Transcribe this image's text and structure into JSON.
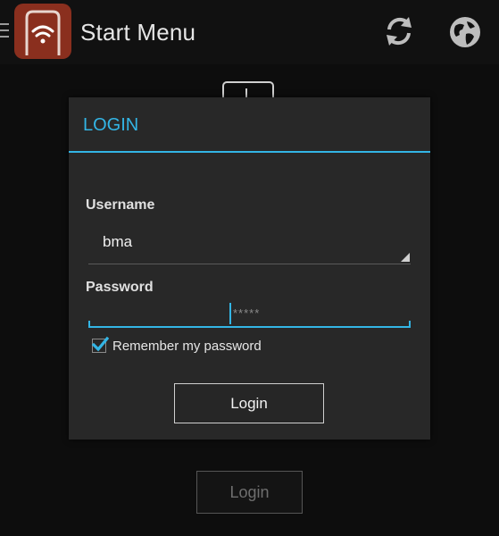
{
  "app": {
    "title": "Start Menu",
    "icon": "wifi-app-icon",
    "accent_color": "#33b5e5",
    "icon_color": "#8a2f1e"
  },
  "toolbar": {
    "refresh_icon": "refresh-icon",
    "globe_icon": "globe-icon"
  },
  "background": {
    "login_button_label": "Login"
  },
  "dialog": {
    "title": "LOGIN",
    "username_label": "Username",
    "username_value": "bma",
    "password_label": "Password",
    "password_hint": "*****",
    "remember_label": "Remember my password",
    "remember_checked": true,
    "login_button_label": "Login"
  }
}
